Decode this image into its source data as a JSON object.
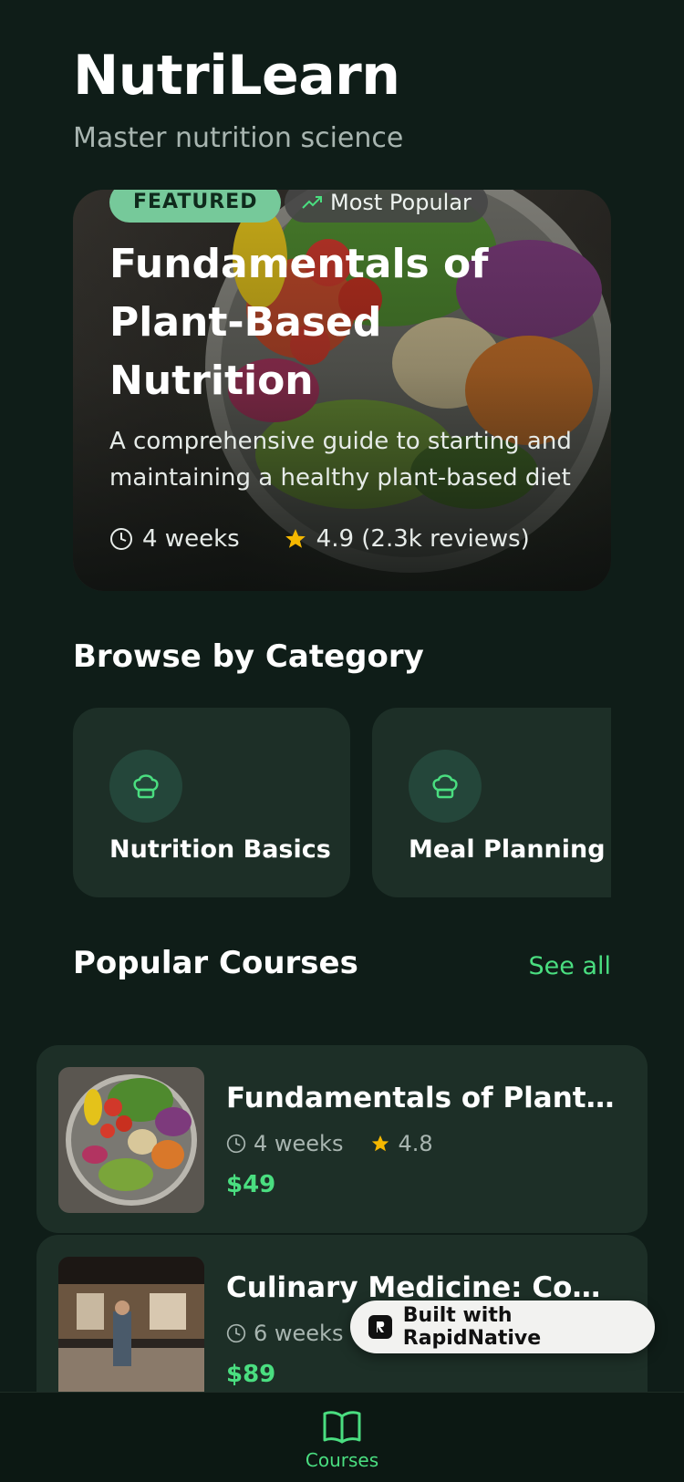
{
  "header": {
    "title": "NutriLearn",
    "subtitle": "Master nutrition science"
  },
  "featured": {
    "badge": "FEATURED",
    "popular_label": "Most Popular",
    "title": "Fundamentals of Plant-Based Nutrition",
    "description": "A comprehensive guide to starting and maintaining a healthy plant-based diet",
    "duration": "4 weeks",
    "rating": "4.9 (2.3k reviews)"
  },
  "categories": {
    "heading": "Browse by Category",
    "items": [
      {
        "label": "Nutrition Basics",
        "icon": "chef-hat-icon"
      },
      {
        "label": "Meal Planning",
        "icon": "chef-hat-icon"
      }
    ]
  },
  "popular": {
    "heading": "Popular Courses",
    "see_all": "See all",
    "courses": [
      {
        "title": "Fundamentals of Plant-Based Nutrition",
        "duration": "4 weeks",
        "rating": "4.8",
        "price": "$49"
      },
      {
        "title": "Culinary Medicine: Cooking for Health",
        "duration": "6 weeks",
        "price": "$89"
      }
    ]
  },
  "built_with": "Built with RapidNative",
  "nav": {
    "courses_label": "Courses"
  },
  "colors": {
    "background": "#0f1d18",
    "card": "#1d2f27",
    "accent": "#4ade80",
    "star": "#f5b800"
  }
}
